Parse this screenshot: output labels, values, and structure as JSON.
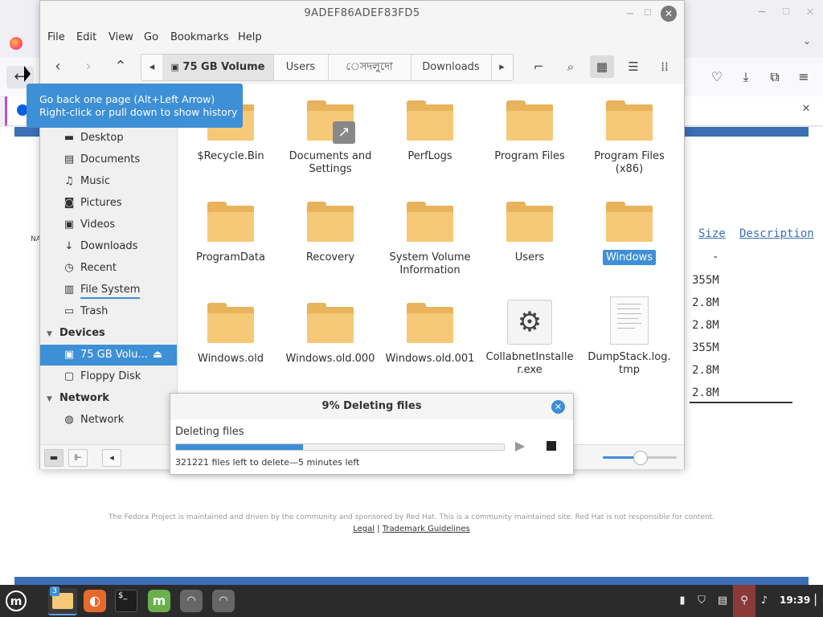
{
  "window": {
    "title": "9ADEF86ADEF83FD5"
  },
  "menu": [
    "File",
    "Edit",
    "View",
    "Go",
    "Bookmarks",
    "Help"
  ],
  "path": {
    "crumbs": [
      "75 GB Volume",
      "Users",
      "েসদলুদো",
      "Downloads"
    ]
  },
  "sidebar": {
    "places": [
      {
        "label": "Desktop",
        "icon": "desktop-icon"
      },
      {
        "label": "Documents",
        "icon": "documents-icon"
      },
      {
        "label": "Music",
        "icon": "music-icon"
      },
      {
        "label": "Pictures",
        "icon": "pictures-icon"
      },
      {
        "label": "Videos",
        "icon": "videos-icon"
      },
      {
        "label": "Downloads",
        "icon": "downloads-icon"
      },
      {
        "label": "Recent",
        "icon": "recent-icon"
      },
      {
        "label": "File System",
        "icon": "filesystem-icon"
      },
      {
        "label": "Trash",
        "icon": "trash-icon"
      }
    ],
    "devices_heading": "Devices",
    "devices": [
      {
        "label": "75 GB Volu...",
        "icon": "drive-icon",
        "selected": true
      },
      {
        "label": "Floppy Disk",
        "icon": "floppy-icon",
        "selected": false
      }
    ],
    "network_heading": "Network",
    "network": [
      {
        "label": "Network",
        "icon": "network-icon"
      }
    ]
  },
  "files": [
    {
      "name": "$Recycle.Bin",
      "type": "folder"
    },
    {
      "name": "Documents and Settings",
      "type": "folder-link"
    },
    {
      "name": "PerfLogs",
      "type": "folder"
    },
    {
      "name": "Program Files",
      "type": "folder"
    },
    {
      "name": "Program Files (x86)",
      "type": "folder"
    },
    {
      "name": "ProgramData",
      "type": "folder"
    },
    {
      "name": "Recovery",
      "type": "folder"
    },
    {
      "name": "System Volume Information",
      "type": "folder"
    },
    {
      "name": "Users",
      "type": "folder"
    },
    {
      "name": "Windows",
      "type": "folder",
      "selected": true
    },
    {
      "name": "Windows.old",
      "type": "folder"
    },
    {
      "name": "Windows.old.000",
      "type": "folder"
    },
    {
      "name": "Windows.old.001",
      "type": "folder"
    },
    {
      "name": "CollabnetInstaller.exe",
      "type": "exe"
    },
    {
      "name": "DumpStack.log.tmp",
      "type": "doc"
    }
  ],
  "tooltip": {
    "line1": "Go back one page (Alt+Left Arrow)",
    "line2": "Right-click or pull down to show history"
  },
  "dialog": {
    "title": "9% Deleting files",
    "status": "Deleting files",
    "progress": 0.09,
    "detail": "321221 files left to delete—5 minutes left"
  },
  "browser": {
    "col_size": "Size",
    "col_description": "Description",
    "sizes": [
      "-",
      "355M",
      "2.8M",
      "2.8M",
      "355M",
      "2.8M",
      "2.8M"
    ],
    "left_label": "NA",
    "footer_text": "The Fedora Project is maintained and driven by the community and sponsored by Red Hat. This is a community maintained site. Red Hat is not responsible for content.",
    "footer_legal": "Legal",
    "footer_sep": "|",
    "footer_trademark": "Trademark Guidelines"
  },
  "taskbar": {
    "badge": "3",
    "clock": "19:39"
  },
  "colors": {
    "accent": "#3d8fd6",
    "folder": "#f6c978",
    "fedora_blue": "#3c6eb4"
  }
}
